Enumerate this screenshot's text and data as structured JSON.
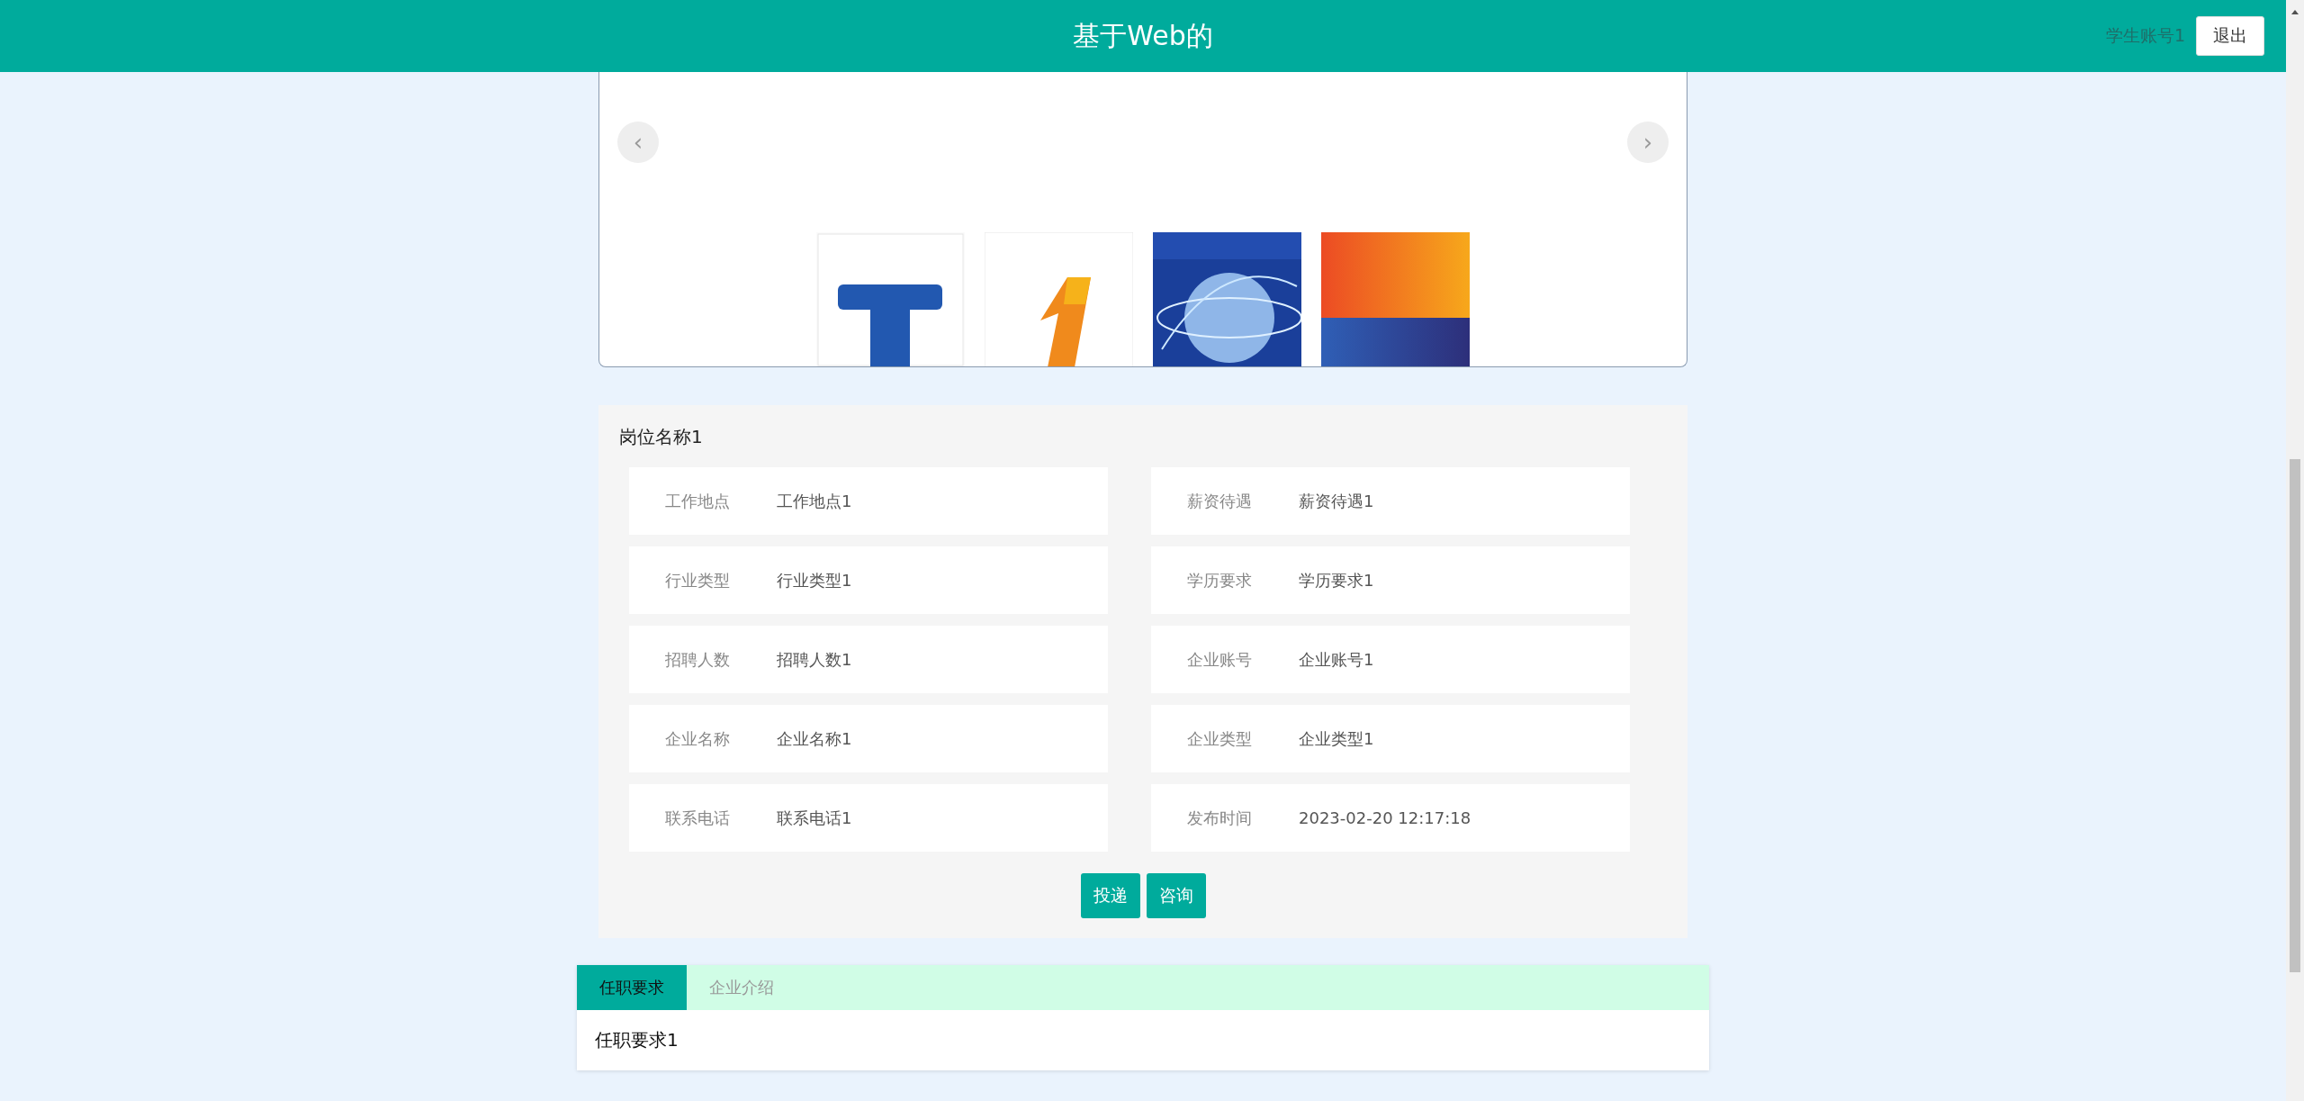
{
  "header": {
    "title": "基于Web的",
    "user": "学生账号1",
    "logout": "退出"
  },
  "carousel": {
    "prev": "‹",
    "next": "›"
  },
  "job": {
    "title": "岗位名称1",
    "fields": [
      {
        "label": "工作地点",
        "value": "工作地点1"
      },
      {
        "label": "薪资待遇",
        "value": "薪资待遇1"
      },
      {
        "label": "行业类型",
        "value": "行业类型1"
      },
      {
        "label": "学历要求",
        "value": "学历要求1"
      },
      {
        "label": "招聘人数",
        "value": "招聘人数1"
      },
      {
        "label": "企业账号",
        "value": "企业账号1"
      },
      {
        "label": "企业名称",
        "value": "企业名称1"
      },
      {
        "label": "企业类型",
        "value": "企业类型1"
      },
      {
        "label": "联系电话",
        "value": "联系电话1"
      },
      {
        "label": "发布时间",
        "value": "2023-02-20 12:17:18"
      }
    ],
    "buttons": [
      "投递",
      "咨询"
    ]
  },
  "tabs": [
    {
      "label": "任职要求",
      "selected": true
    },
    {
      "label": "企业介绍",
      "selected": false
    }
  ],
  "tab_content": "任职要求1"
}
